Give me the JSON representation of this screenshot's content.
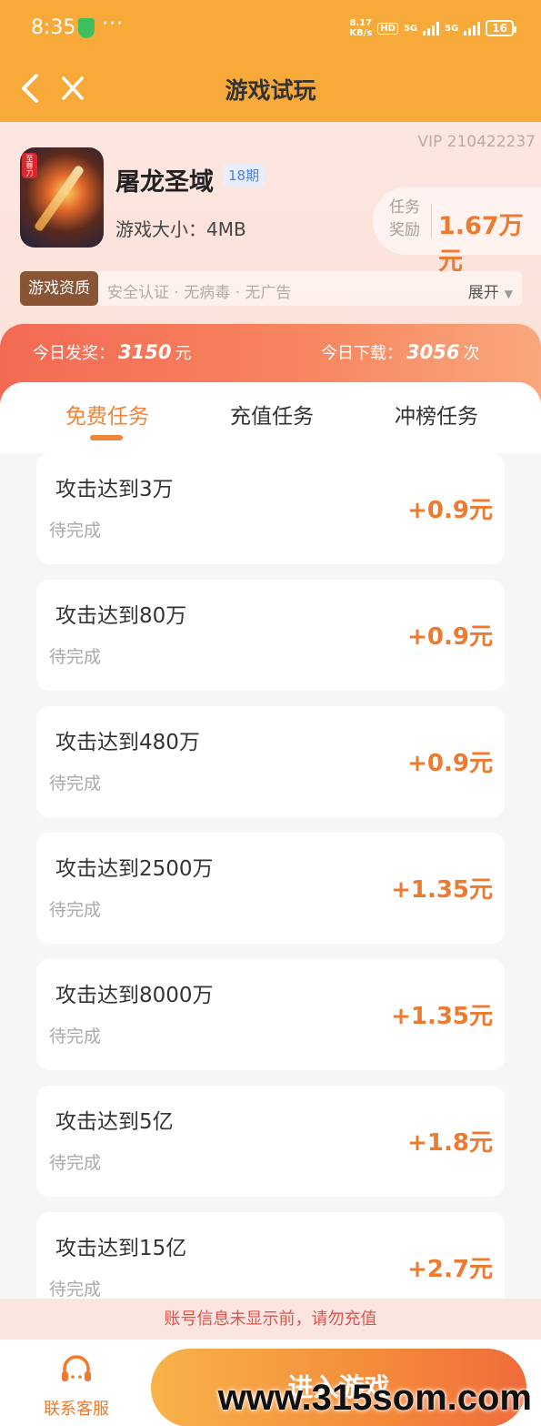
{
  "status_bar": {
    "time": "8:35",
    "dots": "···",
    "net_speed_value": "8.17",
    "net_speed_unit": "KB/s",
    "hd": "HD",
    "sig1": "5G",
    "sig2": "5G",
    "battery": "16"
  },
  "header": {
    "title": "游戏试玩"
  },
  "game": {
    "vip_id": "VIP 210422237",
    "name": "屠龙圣域",
    "period": "18期",
    "size_label": "游戏大小：4MB",
    "reward_label": "任务奖励",
    "reward_value": "1.67万元",
    "icon_badge": "至尊刀"
  },
  "qualification": {
    "tag": "游戏资质",
    "text": "安全认证 · 无病毒 · 无广告",
    "expand": "展开"
  },
  "stats": {
    "payout_label": "今日发奖：",
    "payout_value": "3150",
    "payout_unit": "元",
    "download_label": "今日下载：",
    "download_value": "3056",
    "download_unit": "次"
  },
  "tabs": [
    {
      "label": "免费任务"
    },
    {
      "label": "充值任务"
    },
    {
      "label": "冲榜任务"
    }
  ],
  "tasks": [
    {
      "title": "攻击达到3万",
      "status": "待完成",
      "reward": "+0.9元"
    },
    {
      "title": "攻击达到80万",
      "status": "待完成",
      "reward": "+0.9元"
    },
    {
      "title": "攻击达到480万",
      "status": "待完成",
      "reward": "+0.9元"
    },
    {
      "title": "攻击达到2500万",
      "status": "待完成",
      "reward": "+1.35元"
    },
    {
      "title": "攻击达到8000万",
      "status": "待完成",
      "reward": "+1.35元"
    },
    {
      "title": "攻击达到5亿",
      "status": "待完成",
      "reward": "+1.8元"
    },
    {
      "title": "攻击达到15亿",
      "status": "待完成",
      "reward": "+2.7元"
    }
  ],
  "notice": "账号信息未显示前，请勿充值",
  "footer": {
    "service_label": "联系客服",
    "enter_label": "进入游戏"
  },
  "watermark": "www.315som.com",
  "colors": {
    "header_bg": "#f7a93a",
    "accent": "#ee7a2f",
    "notice_text": "#e0534c"
  }
}
